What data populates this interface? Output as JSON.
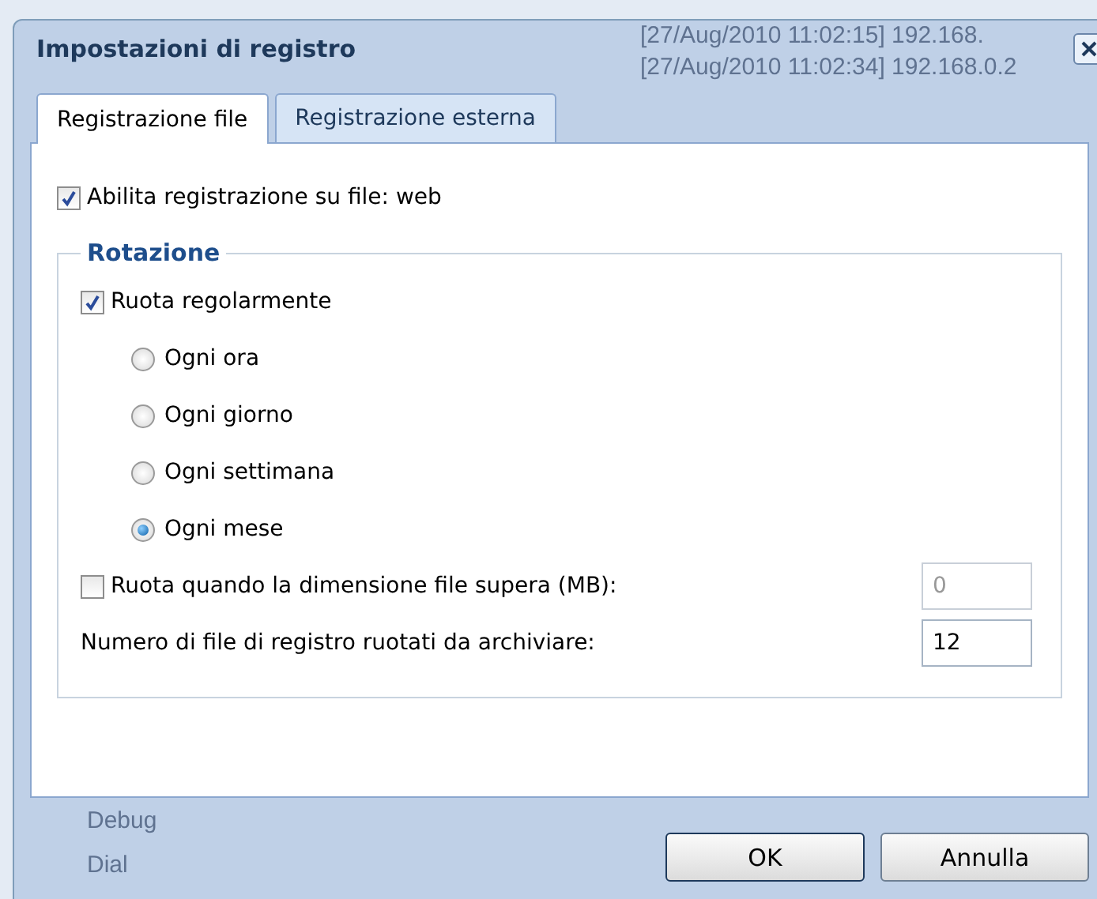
{
  "window": {
    "title": "Impostazioni di registro"
  },
  "background": {
    "log_lines": [
      "[27/Aug/2010 11:02:15] 192.168.",
      "[27/Aug/2010 11:02:34] 192.168.0.2"
    ],
    "sidebar_items": [
      "Debug",
      "Dial"
    ]
  },
  "tabs": [
    {
      "label": "Registrazione file",
      "selected": true
    },
    {
      "label": "Registrazione esterna",
      "selected": false
    }
  ],
  "enable_logging": {
    "label": "Abilita registrazione su file: web",
    "checked": true
  },
  "rotation": {
    "title": "Rotazione",
    "rotate_regularly": {
      "label": "Ruota regolarmente",
      "checked": true
    },
    "intervals": [
      {
        "label": "Ogni ora",
        "selected": false
      },
      {
        "label": "Ogni giorno",
        "selected": false
      },
      {
        "label": "Ogni settimana",
        "selected": false
      },
      {
        "label": "Ogni mese",
        "selected": true
      }
    ],
    "rotate_by_size": {
      "label": "Ruota quando la dimensione file supera (MB):",
      "checked": false,
      "value": "0",
      "disabled": true
    },
    "archive_count": {
      "label": "Numero di file di registro ruotati da archiviare:",
      "value": "12"
    }
  },
  "buttons": [
    "OK",
    "Annulla"
  ]
}
